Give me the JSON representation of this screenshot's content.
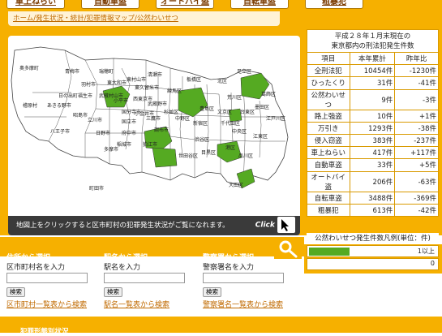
{
  "nav": {
    "tabs": [
      {
        "label": "車上ねらい"
      },
      {
        "label": "自動車盗"
      },
      {
        "label": "オートバイ盗"
      },
      {
        "label": "自転車盗"
      },
      {
        "label": "粗暴犯"
      }
    ]
  },
  "breadcrumb": "ホーム/発生状況・統計/犯罪情報マップ/公然わいせつ",
  "map": {
    "instruction": "地図上をクリックすると区市町村の犯罪発生状況がご覧になれます。",
    "click_label": "Click",
    "highlight_color": "#55aa22",
    "labels": [
      "奥多摩町",
      "青梅市",
      "瑞穂町",
      "檜原村",
      "あきる野市",
      "日の出町",
      "八王子市",
      "町田市",
      "羽村市",
      "福生市",
      "武蔵村山市",
      "東大和市",
      "東村山市",
      "清瀬市",
      "東久留米市",
      "昭島市",
      "立川市",
      "小平市",
      "西東京市",
      "日野市",
      "国立市",
      "国分寺市",
      "小金井市",
      "武蔵野市",
      "三鷹市",
      "府中市",
      "調布市",
      "狛江市",
      "稲城市",
      "多摩市",
      "練馬区",
      "板橋区",
      "北区",
      "足立区",
      "葛飾区",
      "江戸川区",
      "中野区",
      "杉並区",
      "世田谷区",
      "目黒区",
      "渋谷区",
      "新宿区",
      "文京区",
      "台東区",
      "荒川区",
      "墨田区",
      "江東区",
      "中央区",
      "千代田区",
      "港区",
      "品川区",
      "大田区",
      "豊島区"
    ]
  },
  "stats": {
    "caption": [
      "平成２８年１月末現在の",
      "東京都内の刑法犯発生件数"
    ],
    "headers": [
      "項目",
      "本年累計",
      "昨年比"
    ],
    "rows": [
      [
        "全刑法犯",
        "10454件",
        "-1230件"
      ],
      [
        "ひったくり",
        "31件",
        "-41件"
      ],
      [
        "公然わいせつ",
        "9件",
        "-3件"
      ],
      [
        "路上強盗",
        "10件",
        "+1件"
      ],
      [
        "万引き",
        "1293件",
        "-38件"
      ],
      [
        "侵入窃盗",
        "383件",
        "-237件"
      ],
      [
        "車上ねらい",
        "417件",
        "+117件"
      ],
      [
        "自動車盗",
        "33件",
        "+5件"
      ],
      [
        "オートバイ盗",
        "206件",
        "-63件"
      ],
      [
        "自転車盗",
        "3488件",
        "-369件"
      ],
      [
        "粗暴犯",
        "613件",
        "-42件"
      ]
    ]
  },
  "legend": {
    "title": "公然わいせつ発生件数凡例(単位：件)",
    "items": [
      {
        "label": "1以上",
        "color": "#55aa22"
      },
      {
        "label": "0",
        "color": "#ffffff"
      }
    ]
  },
  "search": {
    "columns": [
      {
        "title": "住所から選択",
        "label": "区市町村名を入力",
        "button": "検索",
        "link": "区市町村一覧表から検索"
      },
      {
        "title": "駅名から選択",
        "label": "駅名を入力",
        "button": "検索",
        "link": "駅名一覧表から検索"
      },
      {
        "title": "警察署から選択",
        "label": "警察署名を入力",
        "button": "検索",
        "link": "警察署名一覧表から検索"
      }
    ]
  },
  "bottom": {
    "tab": "犯罪形態別状況"
  }
}
